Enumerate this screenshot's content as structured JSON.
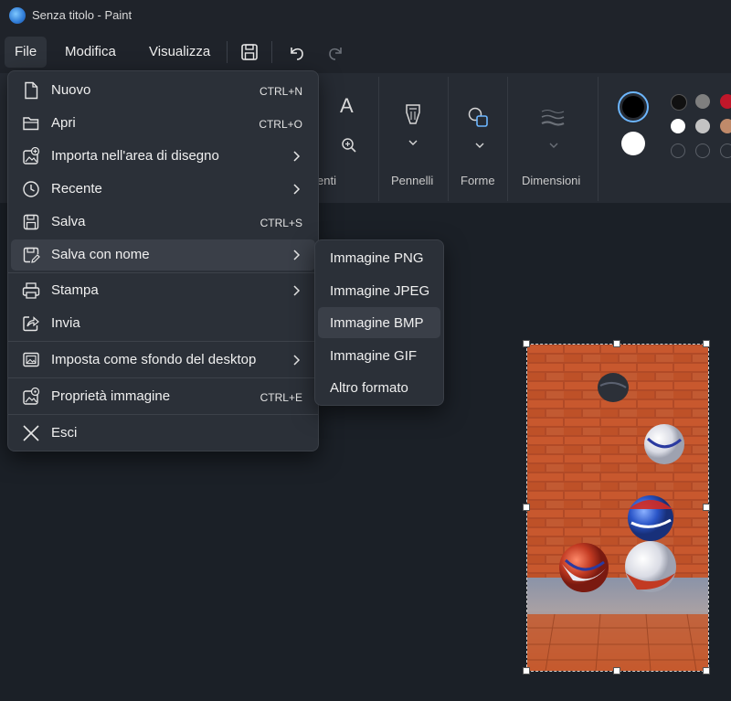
{
  "window": {
    "title": "Senza titolo - Paint"
  },
  "menubar": {
    "file": "File",
    "modifica": "Modifica",
    "visualizza": "Visualizza"
  },
  "ribbon": {
    "group_strumenti_partial": "enti",
    "pennelli": "Pennelli",
    "forme": "Forme",
    "dimensioni": "Dimensioni",
    "text_tool_glyph": "A"
  },
  "file_menu": {
    "items": [
      {
        "label": "Nuovo",
        "shortcut": "CTRL+N"
      },
      {
        "label": "Apri",
        "shortcut": "CTRL+O"
      },
      {
        "label": "Importa nell'area di disegno"
      },
      {
        "label": "Recente"
      },
      {
        "label": "Salva",
        "shortcut": "CTRL+S"
      },
      {
        "label": "Salva con nome"
      },
      {
        "label": "Stampa"
      },
      {
        "label": "Invia"
      },
      {
        "label": "Imposta come sfondo del desktop"
      },
      {
        "label": "Proprietà immagine",
        "shortcut": "CTRL+E"
      },
      {
        "label": "Esci"
      }
    ]
  },
  "save_as_submenu": {
    "items": [
      "Immagine PNG",
      "Immagine JPEG",
      "Immagine BMP",
      "Immagine GIF",
      "Altro formato"
    ]
  },
  "colors": {
    "primary": "#000000",
    "secondary": "#ffffff",
    "palette": [
      "#111111",
      "#7f7f7f",
      "#c0172a",
      "#ffffff",
      "#c3c3c3",
      "#c08a6a"
    ]
  }
}
